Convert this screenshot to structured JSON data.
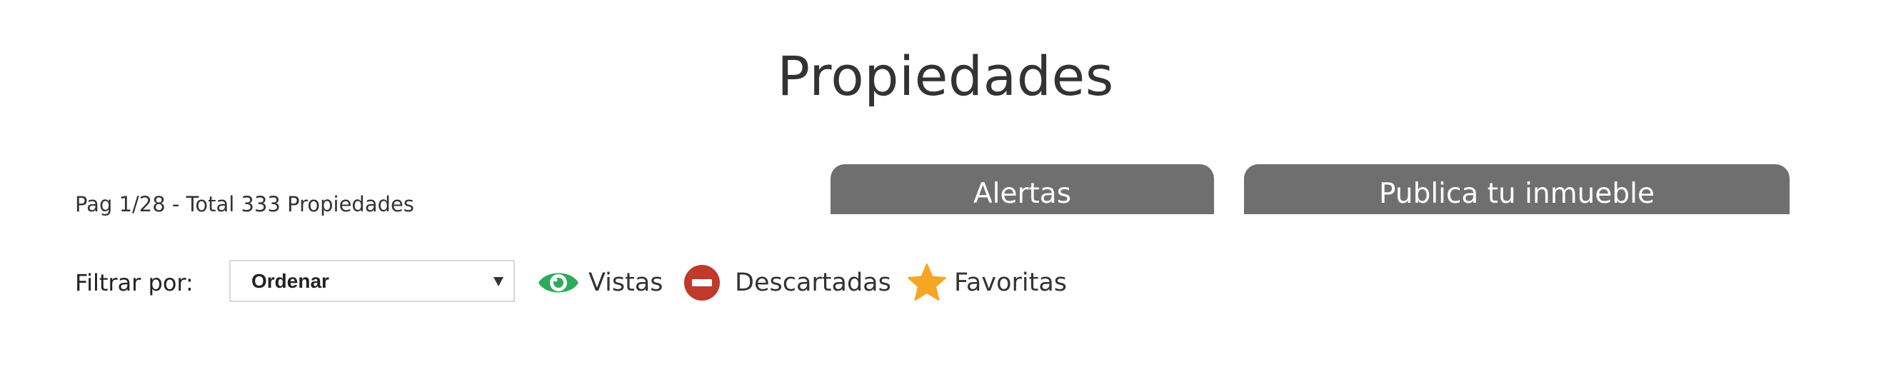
{
  "page": {
    "title": "Propiedades"
  },
  "pager": {
    "text": "Pag 1/28 - Total 333 Propiedades"
  },
  "tabs": {
    "alertas_label": "Alertas",
    "publica_label": "Publica tu inmueble",
    "background_color": "#6f6f6f"
  },
  "filters": {
    "label": "Filtrar por:",
    "sort_select": {
      "selected": "Ordenar"
    },
    "items": [
      {
        "label": "Vistas",
        "icon": "eye-icon",
        "color": "#2eaa5b"
      },
      {
        "label": "Descartadas",
        "icon": "minus-circle-icon",
        "color": "#c0392b"
      },
      {
        "label": "Favoritas",
        "icon": "star-icon",
        "color": "#f5a623"
      }
    ]
  }
}
